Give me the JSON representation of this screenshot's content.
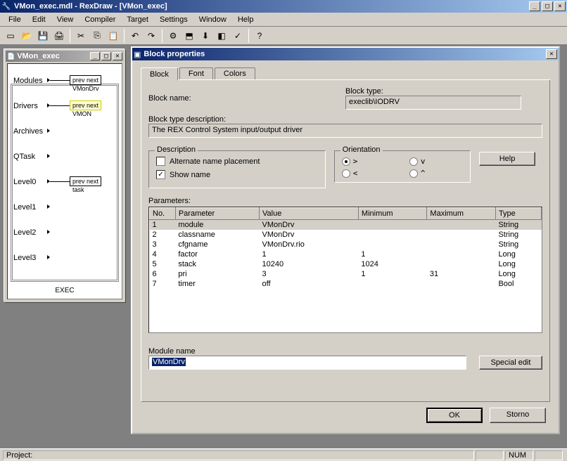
{
  "window": {
    "title": "VMon_exec.mdl - RexDraw - [VMon_exec]"
  },
  "menu": {
    "items": [
      "File",
      "Edit",
      "View",
      "Compiler",
      "Target",
      "Settings",
      "Window",
      "Help"
    ]
  },
  "toolbar": {
    "icons": [
      {
        "name": "new-icon",
        "glyph": "▭"
      },
      {
        "name": "open-icon",
        "glyph": "📂"
      },
      {
        "name": "save-icon",
        "glyph": "💾"
      },
      {
        "name": "print-icon",
        "glyph": "🖨"
      },
      {
        "sep": true
      },
      {
        "name": "cut-icon",
        "glyph": "✂"
      },
      {
        "name": "copy-icon",
        "glyph": "⎘"
      },
      {
        "name": "paste-icon",
        "glyph": "📋"
      },
      {
        "sep": true
      },
      {
        "name": "undo-icon",
        "glyph": "↶"
      },
      {
        "name": "redo-icon",
        "glyph": "↷"
      },
      {
        "sep": true
      },
      {
        "name": "compile-icon",
        "glyph": "⚙"
      },
      {
        "name": "config-icon",
        "glyph": "⬒"
      },
      {
        "name": "download-icon",
        "glyph": "⬇"
      },
      {
        "name": "monitor-icon",
        "glyph": "◧"
      },
      {
        "name": "diag-icon",
        "glyph": "✓"
      },
      {
        "sep": true
      },
      {
        "name": "help-icon",
        "glyph": "?"
      }
    ]
  },
  "child_window": {
    "title": "VMon_exec"
  },
  "diagram": {
    "ports": [
      "Modules",
      "Drivers",
      "Archives",
      "QTask",
      "Level0",
      "Level1",
      "Level2",
      "Level3"
    ],
    "blocks": [
      {
        "port": "Modules",
        "text": "prev  next",
        "label": "VMonDrv",
        "selected": false
      },
      {
        "port": "Drivers",
        "text": "prev  next",
        "label": "VMON",
        "selected": true
      },
      {
        "port": "Level0",
        "text": "prev  next",
        "label": "task",
        "selected": false
      }
    ],
    "container_label": "EXEC"
  },
  "dialog": {
    "title": "Block properties",
    "tabs": [
      "Block",
      "Font",
      "Colors"
    ],
    "active_tab": 0,
    "block_name_label": "Block name:",
    "block_type_label": "Block type:",
    "block_type_value": "execlib\\IODRV",
    "desc_label": "Block type description:",
    "desc_value": "The REX Control System input/output driver",
    "fs_description": {
      "legend": "Description",
      "alt_name": "Alternate name placement",
      "show_name": "Show name",
      "show_name_checked": true
    },
    "fs_orientation": {
      "legend": "Orientation",
      "opts": [
        ">",
        "v",
        "<",
        "^"
      ],
      "selected": 0
    },
    "help_btn": "Help",
    "params_label": "Parameters:",
    "columns": [
      "No.",
      "Parameter",
      "Value",
      "Minimum",
      "Maximum",
      "Type"
    ],
    "rows": [
      [
        "1",
        "module",
        "VMonDrv",
        "",
        "",
        "String"
      ],
      [
        "2",
        "classname",
        "VMonDrv",
        "",
        "",
        "String"
      ],
      [
        "3",
        "cfgname",
        "VMonDrv.rio",
        "",
        "",
        "String"
      ],
      [
        "4",
        "factor",
        "1",
        "1",
        "",
        "Long"
      ],
      [
        "5",
        "stack",
        "10240",
        "1024",
        "",
        "Long"
      ],
      [
        "6",
        "pri",
        "3",
        "1",
        "31",
        "Long"
      ],
      [
        "7",
        "timer",
        "off",
        "",
        "",
        "Bool"
      ]
    ],
    "selected_row": 0,
    "module_name_label": "Module name",
    "module_name_value": "VMonDrv",
    "special_btn": "Special edit",
    "ok_btn": "OK",
    "cancel_btn": "Storno"
  },
  "statusbar": {
    "project_label": "Project:",
    "num": "NUM"
  }
}
